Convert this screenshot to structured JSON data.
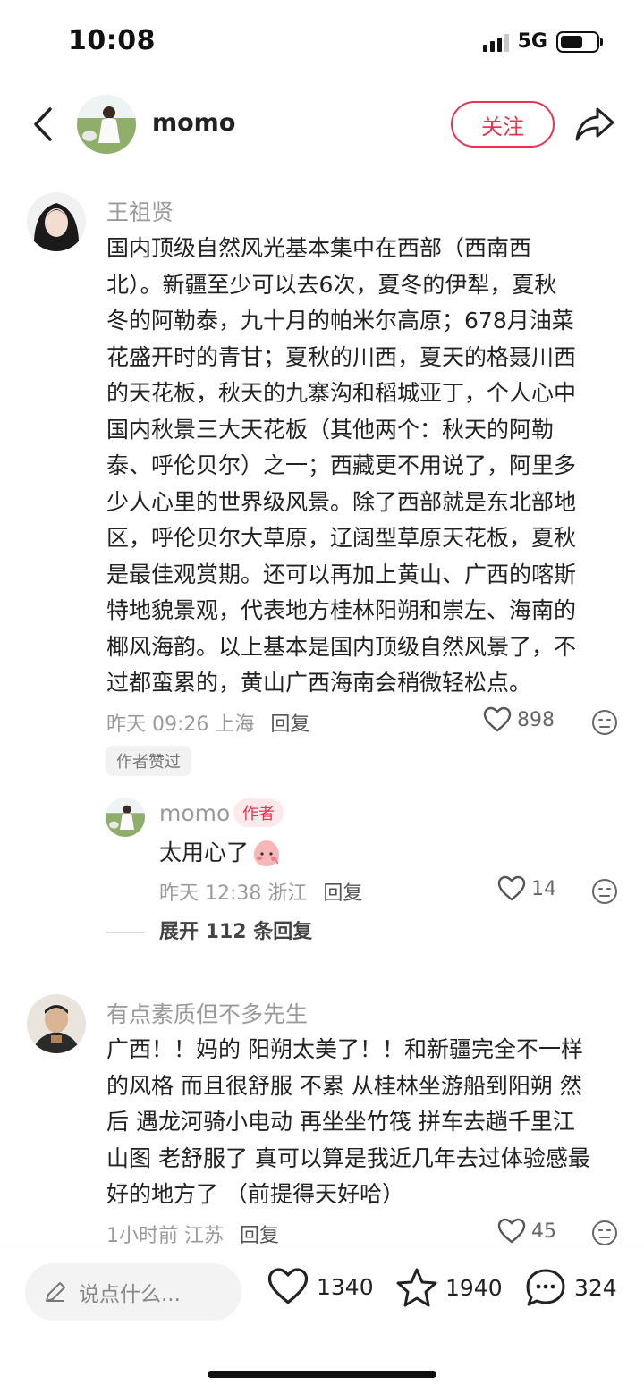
{
  "status": {
    "time": "10:08",
    "network": "5G"
  },
  "header": {
    "username": "momo",
    "follow_label": "关注"
  },
  "comments": [
    {
      "username": "王祖贤",
      "lines": [
        "国内顶级自然风光基本集中在西部（西南西",
        "北）。新疆至少可以去6次，夏冬的伊犁，夏秋",
        "冬的阿勒泰，九十月的帕米尔高原；678月油菜",
        "花盛开时的青甘；夏秋的川西，夏天的格聂川西",
        "的天花板，秋天的九寨沟和稻城亚丁，个人心中",
        "国内秋景三大天花板（其他两个：秋天的阿勒",
        "泰、呼伦贝尔）之一；西藏更不用说了，阿里多",
        "少人心里的世界级风景。除了西部就是东北部地",
        "区，呼伦贝尔大草原，辽阔型草原天花板，夏秋",
        "是最佳观赏期。还可以再加上黄山、广西的喀斯",
        "特地貌景观，代表地方桂林阳朔和崇左、海南的",
        "椰风海韵。以上基本是国内顶级自然风景了，不",
        "过都蛮累的，黄山广西海南会稍微轻松点。"
      ],
      "time": "昨天 09:26",
      "location": "上海",
      "reply_label": "回复",
      "likes": "898",
      "author_liked": "作者赞过"
    },
    {
      "username": "有点素质但不多先生",
      "lines": [
        "广西！！妈的 阳朔太美了！！和新疆完全不一样",
        "的风格 而且很舒服 不累 从桂林坐游船到阳朔 然",
        "后 遇龙河骑小电动 再坐坐竹筏 拼车去趟千里江",
        "山图 老舒服了 真可以算是我近几年去过体验感最",
        "好的地方了 （前提得天好哈）"
      ],
      "time": "1小时前",
      "location": "江苏",
      "reply_label": "回复",
      "likes": "45"
    }
  ],
  "reply": {
    "username": "momo",
    "author_tag": "作者",
    "text": "太用心了",
    "time": "昨天 12:38",
    "location": "浙江",
    "reply_label": "回复",
    "likes": "14",
    "expand_label": "展开 112 条回复"
  },
  "bottom_bar": {
    "input_placeholder": "说点什么...",
    "likes": "1340",
    "favorites": "1940",
    "comments": "324"
  },
  "colors": {
    "accent": "#e8344e",
    "muted": "#9a9a9a"
  },
  "icons": [
    "back-icon",
    "share-icon",
    "heart-icon",
    "emoji-icon",
    "pencil-icon",
    "star-icon",
    "chat-bubble-icon",
    "blush-emoji"
  ]
}
